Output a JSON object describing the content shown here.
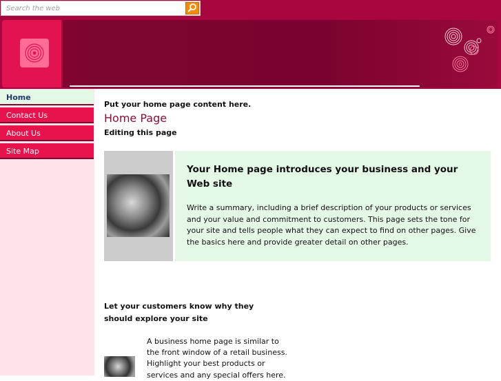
{
  "search": {
    "placeholder": "Search the web"
  },
  "nav": {
    "items": [
      {
        "label": "Home",
        "active": true
      },
      {
        "label": "Contact Us",
        "active": false
      },
      {
        "label": "About Us",
        "active": false
      },
      {
        "label": "Site Map",
        "active": false
      }
    ]
  },
  "main": {
    "intro": "Put your home page content here.",
    "title": "Home Page",
    "subtitle": "Editing this page",
    "feature": {
      "title": "Your Home page introduces your business and your Web site",
      "body": "Write a summary, including a brief description of your products or services and your value and commitment to customers. This page sets the tone for your site and tells people what they can expect to find on other pages. Give the basics here and provide greater detail on other pages."
    },
    "section2": {
      "title": "Let your customers know why they should explore your site",
      "body": "A business home page is similar to the front window of a retail business. Highlight your best products or services and any special offers here."
    }
  },
  "colors": {
    "brand": "#a8063e",
    "nav_item": "#e8134d",
    "active_nav": "#e4f8e6",
    "sidebar": "#ffe3eb",
    "title": "#8a0d3a",
    "search_button": "#f28a0c"
  },
  "icons": {
    "search": "search-icon",
    "logo": "target-rings-icon",
    "decoration": "swirl-circles-icon"
  }
}
